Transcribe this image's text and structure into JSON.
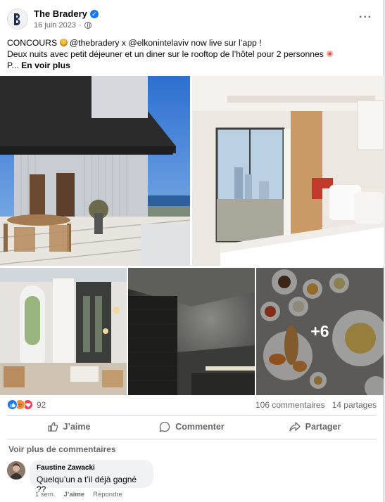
{
  "post": {
    "page_name": "The Bradery",
    "date": "16 juin 2023",
    "date_separator": "·",
    "more_icon": "three-dots-icon",
    "text_line1_prefix": "CONCOURS",
    "text_line1_rest": "@thebradery x @elkonintelaviv now live sur l’app !",
    "text_line2": "Deux nuits avec petit déjeuner et un diner sur le rooftop de l’hôtel pour 2 personnes",
    "text_line3_prefix": "P...",
    "see_more": "En voir plus"
  },
  "gallery": {
    "photos": [
      {
        "name": "rooftop-terrace-photo"
      },
      {
        "name": "hotel-bedroom-photo"
      },
      {
        "name": "restaurant-interior-photo"
      },
      {
        "name": "hammam-spa-photo"
      },
      {
        "name": "breakfast-table-photo"
      }
    ],
    "more_count": "+6"
  },
  "stats": {
    "reaction_icons": [
      "like-icon",
      "angry-icon",
      "love-icon"
    ],
    "reaction_count": "92",
    "comments": "106 commentaires",
    "shares": "14 partages"
  },
  "actions": {
    "like": "J’aime",
    "comment": "Commenter",
    "share": "Partager"
  },
  "comments": {
    "view_more": "Voir plus de commentaires",
    "items": [
      {
        "author": "Faustine Zawacki",
        "text": "Quelqu’un a t’il déjà gagné ??",
        "time": "1 sem.",
        "like": "J’aime",
        "reply": "Répondre"
      }
    ]
  },
  "colors": {
    "accent": "#1877f2",
    "secondary_text": "#65676b",
    "bubble": "#f0f2f5"
  }
}
